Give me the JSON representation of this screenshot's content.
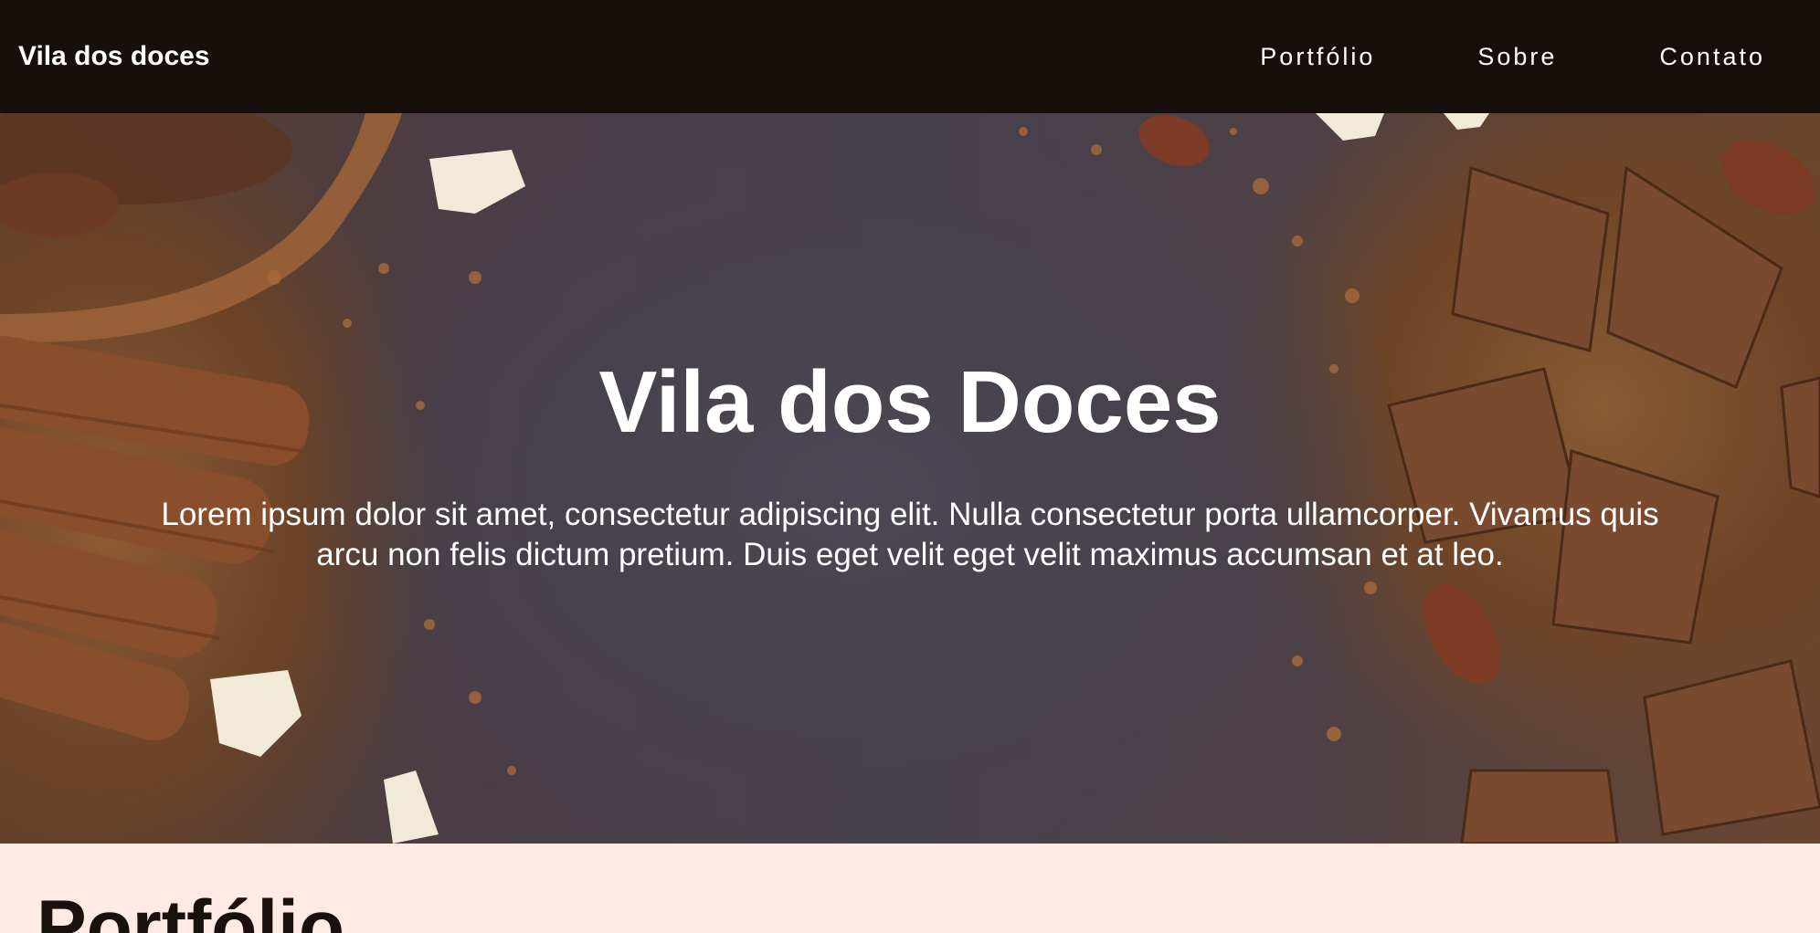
{
  "navbar": {
    "brand": "Vila dos doces",
    "links": [
      "Portfólio",
      "Sobre",
      "Contato"
    ]
  },
  "hero": {
    "title": "Vila dos Doces",
    "text": "Lorem ipsum dolor sit amet, consectetur adipiscing elit. Nulla consectetur porta ullamcorper. Vivamus quis arcu non felis dictum pretium. Duis eget velit eget velit maximus accumsan et at leo.",
    "background_image": "chocolate-and-cinnamon-photo"
  },
  "portfolio": {
    "title": "Portfólio"
  },
  "colors": {
    "navbar_bg": "#170f0b",
    "section_bg": "#ffebe4",
    "text_light": "#ffffff",
    "text_dark": "#1a110d"
  }
}
